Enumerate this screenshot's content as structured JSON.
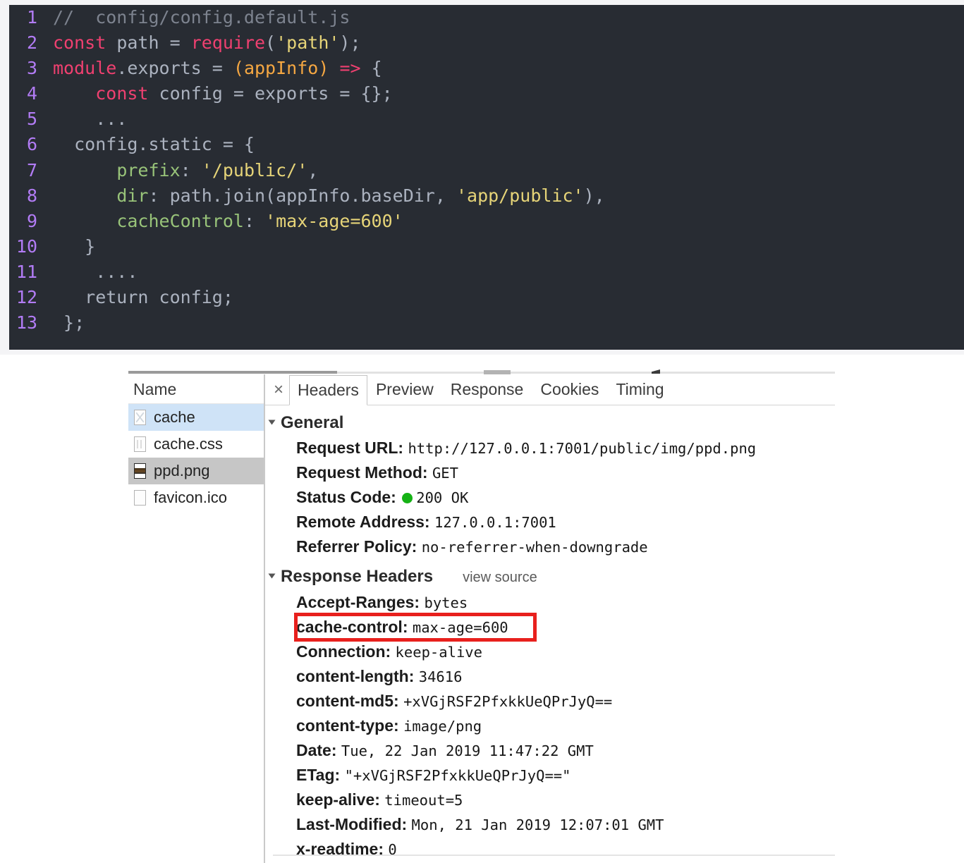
{
  "code_block": {
    "language": "javascript",
    "theme_background": "#282c33",
    "lines": [
      {
        "num": "1",
        "segments": [
          {
            "t": "// ",
            "c": "tok-comment"
          },
          {
            "t": " config/config.default.js",
            "c": "tok-comment"
          }
        ]
      },
      {
        "num": "2",
        "segments": [
          {
            "t": "const",
            "c": "tok-kw"
          },
          {
            "t": " path ",
            "c": "code-text"
          },
          {
            "t": "= ",
            "c": "code-text"
          },
          {
            "t": "require",
            "c": "tok-fn"
          },
          {
            "t": "(",
            "c": "tok-punct"
          },
          {
            "t": "'path'",
            "c": "tok-str"
          },
          {
            "t": ");",
            "c": "tok-punct"
          }
        ]
      },
      {
        "num": "3",
        "segments": [
          {
            "t": "module",
            "c": "tok-mod"
          },
          {
            "t": ".exports = ",
            "c": "code-text"
          },
          {
            "t": "(",
            "c": "tok-param"
          },
          {
            "t": "appInfo",
            "c": "tok-param"
          },
          {
            "t": ")",
            "c": "tok-param"
          },
          {
            "t": " ",
            "c": "code-text"
          },
          {
            "t": "=>",
            "c": "tok-arrow"
          },
          {
            "t": " {",
            "c": "code-text"
          }
        ]
      },
      {
        "num": "4",
        "segments": [
          {
            "t": "    ",
            "c": "code-text"
          },
          {
            "t": "const",
            "c": "tok-kw"
          },
          {
            "t": " config = exports = {};",
            "c": "code-text"
          }
        ]
      },
      {
        "num": "5",
        "segments": [
          {
            "t": "    ...",
            "c": "code-text"
          }
        ]
      },
      {
        "num": "6",
        "segments": [
          {
            "t": "  config.static = {",
            "c": "code-text"
          }
        ]
      },
      {
        "num": "7",
        "segments": [
          {
            "t": "      ",
            "c": "code-text"
          },
          {
            "t": "prefix",
            "c": "tok-prop"
          },
          {
            "t": ": ",
            "c": "code-text"
          },
          {
            "t": "'/public/'",
            "c": "tok-str"
          },
          {
            "t": ",",
            "c": "code-text"
          }
        ]
      },
      {
        "num": "8",
        "segments": [
          {
            "t": "      ",
            "c": "code-text"
          },
          {
            "t": "dir",
            "c": "tok-prop"
          },
          {
            "t": ": path.join(appInfo.baseDir, ",
            "c": "code-text"
          },
          {
            "t": "'app/public'",
            "c": "tok-str"
          },
          {
            "t": "),",
            "c": "code-text"
          }
        ]
      },
      {
        "num": "9",
        "segments": [
          {
            "t": "      ",
            "c": "code-text"
          },
          {
            "t": "cacheControl",
            "c": "tok-prop"
          },
          {
            "t": ": ",
            "c": "code-text"
          },
          {
            "t": "'max-age=600'",
            "c": "tok-str"
          }
        ]
      },
      {
        "num": "10",
        "segments": [
          {
            "t": "   }",
            "c": "code-text"
          }
        ]
      },
      {
        "num": "11",
        "segments": [
          {
            "t": "    ....",
            "c": "code-text"
          }
        ]
      },
      {
        "num": "12",
        "segments": [
          {
            "t": "   return config;",
            "c": "code-text"
          }
        ]
      },
      {
        "num": "13",
        "segments": [
          {
            "t": " };",
            "c": "code-text"
          }
        ]
      }
    ]
  },
  "devtools": {
    "file_panel": {
      "column_header": "Name",
      "files": [
        {
          "name": "cache",
          "icon": "document-icon",
          "state": "selected-blue"
        },
        {
          "name": "cache.css",
          "icon": "stylesheet-icon",
          "state": "normal"
        },
        {
          "name": "ppd.png",
          "icon": "image-icon",
          "state": "selected-grey"
        },
        {
          "name": "favicon.ico",
          "icon": "document-icon",
          "state": "normal"
        }
      ]
    },
    "tabs": {
      "close_label": "×",
      "items": [
        {
          "label": "Headers",
          "active": true
        },
        {
          "label": "Preview",
          "active": false
        },
        {
          "label": "Response",
          "active": false
        },
        {
          "label": "Cookies",
          "active": false
        },
        {
          "label": "Timing",
          "active": false
        }
      ]
    },
    "general": {
      "title": "General",
      "rows": [
        {
          "key": "Request URL:",
          "value": "http://127.0.0.1:7001/public/img/ppd.png",
          "dot": false
        },
        {
          "key": "Request Method:",
          "value": "GET",
          "dot": false
        },
        {
          "key": "Status Code:",
          "value": "200 OK",
          "dot": true,
          "dot_color": "#15b215"
        },
        {
          "key": "Remote Address:",
          "value": "127.0.0.1:7001",
          "dot": false
        },
        {
          "key": "Referrer Policy:",
          "value": "no-referrer-when-downgrade",
          "dot": false
        }
      ]
    },
    "response_headers": {
      "title": "Response Headers",
      "view_source": "view source",
      "rows": [
        {
          "key": "Accept-Ranges:",
          "value": "bytes",
          "highlighted": false
        },
        {
          "key": "cache-control:",
          "value": "max-age=600",
          "highlighted": true
        },
        {
          "key": "Connection:",
          "value": "keep-alive",
          "highlighted": false
        },
        {
          "key": "content-length:",
          "value": "34616",
          "highlighted": false
        },
        {
          "key": "content-md5:",
          "value": "+xVGjRSF2PfxkkUeQPrJyQ==",
          "highlighted": false
        },
        {
          "key": "content-type:",
          "value": "image/png",
          "highlighted": false
        },
        {
          "key": "Date:",
          "value": "Tue, 22 Jan 2019 11:47:22 GMT",
          "highlighted": false
        },
        {
          "key": "ETag:",
          "value": "\"+xVGjRSF2PfxkkUeQPrJyQ==\"",
          "highlighted": false
        },
        {
          "key": "keep-alive:",
          "value": "timeout=5",
          "highlighted": false
        },
        {
          "key": "Last-Modified:",
          "value": "Mon, 21 Jan 2019 12:07:01 GMT",
          "highlighted": false
        },
        {
          "key": "x-readtime:",
          "value": "0",
          "highlighted": false
        }
      ]
    },
    "annotation": {
      "highlight_color": "#e8201d",
      "highlight_target": "cache-control: max-age=600"
    }
  }
}
